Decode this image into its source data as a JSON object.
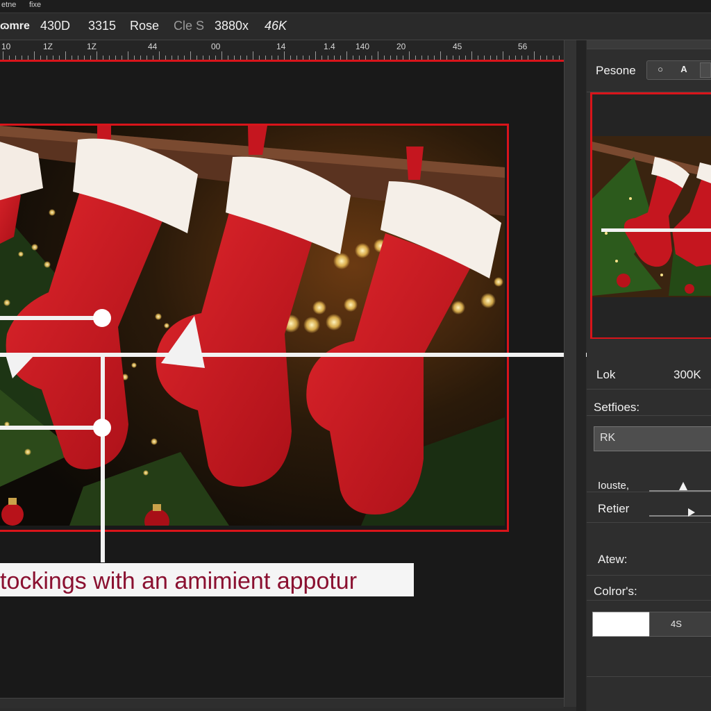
{
  "menu": {
    "items": [
      "etne",
      "fixe"
    ]
  },
  "options_bar": {
    "items": [
      "ɷmre",
      "430D",
      "3315",
      "Rose",
      "Cle S",
      "3880x",
      "46K"
    ]
  },
  "ruler": {
    "labels": [
      "10",
      "1Z",
      "1Z",
      "44",
      "00",
      "14",
      "1.4",
      "140",
      "20",
      "45",
      "56"
    ]
  },
  "caption": {
    "text": "tockings with an amimient appotur"
  },
  "panel": {
    "header_label": "Pesone",
    "buttons": [
      "○",
      "A",
      ""
    ],
    "lok_label": "Lok",
    "lok_value": "300K",
    "settings_label": "Setfioes:",
    "field_value": "RK",
    "slider1_label": "Iouste,",
    "slider2_label": "Retier",
    "atew_label": "Atew:",
    "colors_label": "Colror's:",
    "color_value": "4S"
  },
  "colors": {
    "accent": "#d9141a",
    "caption_text": "#8a1030",
    "stocking": "#c5161f"
  }
}
